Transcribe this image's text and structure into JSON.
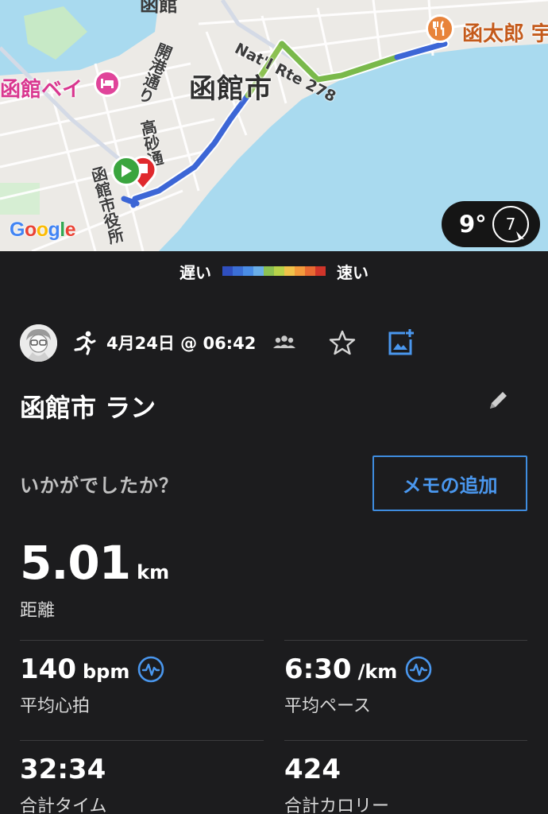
{
  "map": {
    "city_label": "函館市",
    "bay_label": "函館ベイ",
    "restaurant_label": "函太郎 宇",
    "top_partial_label": "函館",
    "route_label": "Nat'l Rte 278",
    "street_1": "開港通り",
    "street_2": "高砂通",
    "street_3": "函館市役所",
    "google_logo": "Google",
    "temperature": "9°",
    "wind": "7"
  },
  "legend": {
    "slow_label": "遅い",
    "fast_label": "速い",
    "colors": [
      "#2f4fbf",
      "#3b6fd6",
      "#4a8de6",
      "#6aaee8",
      "#8cc152",
      "#b8d24a",
      "#f0c24a",
      "#f39a3c",
      "#e86a32",
      "#d0352a"
    ]
  },
  "activity": {
    "date": "4月24日 @ 06:42",
    "title": "函館市 ラン",
    "prompt": "いかがでしたか？",
    "memo_button": "メモの追加"
  },
  "stats": {
    "distance_value": "5.01",
    "distance_unit": "km",
    "distance_label": "距離",
    "hr_value": "140",
    "hr_unit": "bpm",
    "hr_label": "平均心拍",
    "pace_value": "6:30",
    "pace_unit": "/km",
    "pace_label": "平均ペース",
    "time_value": "32:34",
    "time_label": "合計タイム",
    "calories_value": "424",
    "calories_label": "合計カロリー"
  },
  "colors": {
    "background": "#1c1c1e",
    "accent_blue": "#4a97ee",
    "water": "#a9daef"
  }
}
